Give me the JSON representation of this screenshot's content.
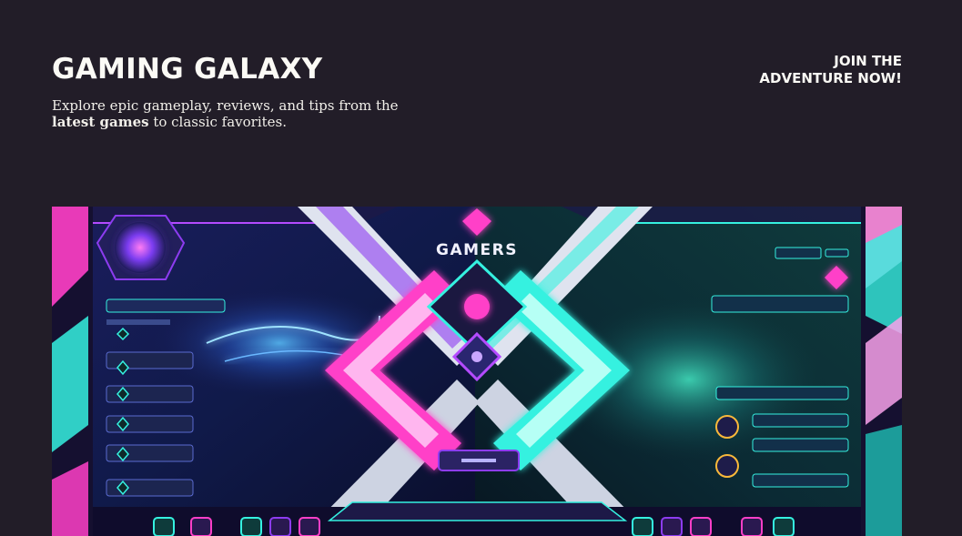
{
  "header": {
    "site_title": "GAMING GALAXY",
    "tagline_before": "Explore epic gameplay, reviews, and tips from the ",
    "tagline_bold": "latest games",
    "tagline_after": " to classic favorites.",
    "cta_label": "JOIN THE ADVENTURE NOW!"
  },
  "hero": {
    "logo_text": "GAMERS",
    "colors": {
      "pink": "#ff3fc8",
      "cyan": "#35f1e0",
      "purple": "#8d3cf0",
      "navy": "#0f0c2c"
    }
  }
}
